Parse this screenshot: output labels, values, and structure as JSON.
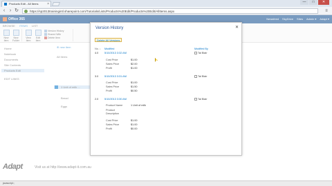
{
  "browser": {
    "tab_title": "Products Edit - All Items",
    "tab_close": "×",
    "url": "https://sp2013trainingintl.sharepoint.com/Tutorials/Lists/Products%20Edit/Products%20Edit/AllItems.aspx",
    "win_min": "—",
    "win_max": "□",
    "win_close": "✕",
    "back": "‹",
    "forward": "›",
    "refresh": "↻",
    "menu": "≡"
  },
  "suite": {
    "logo": "Office 365",
    "right_items": [
      "Newsfeed",
      "SkyDrive",
      "Sites",
      "Admin ▾",
      "Adapt ▾"
    ]
  },
  "ribbon": {
    "tabs": [
      "BROWSE",
      "ITEMS",
      "LIST"
    ],
    "active_tab": "ITEMS",
    "buttons": {
      "new_item": "New Item",
      "new_folder": "New Folder",
      "view_item": "View Item",
      "edit_item": "Edit Item",
      "version_history": "Version History",
      "shared_with": "Shared With",
      "delete_item": "Delete Item",
      "group_new": "New",
      "group_manage": "Manage"
    }
  },
  "leftnav": {
    "items": [
      "Home",
      "Notebook",
      "Documents",
      "Site Contents",
      "Products Edit",
      "EDIT LINKS"
    ]
  },
  "list": {
    "new_item": "⊕ new item",
    "header": "All Items",
    "selected_row": "1 Unit of milk ...",
    "row2": "Bread",
    "row3": "Eggs"
  },
  "dialog": {
    "title": "Version History",
    "close": "✕",
    "delete_all": "Delete All Versions",
    "col_no": "No. ↓",
    "col_modified": "Modified",
    "col_modified_by": "Modified By",
    "versions": [
      {
        "no": "4.0",
        "modified": "5/10/2013 3:32 AM",
        "by": "Tal Blair",
        "fields": [
          {
            "name": "Cost Price",
            "value": "$1.00"
          },
          {
            "name": "Sales Price",
            "value": "$2.00"
          },
          {
            "name": "Profit",
            "value": "$1.00"
          }
        ]
      },
      {
        "no": "3.0",
        "modified": "5/10/2013 3:31 AM",
        "by": "Tal Blair",
        "fields": [
          {
            "name": "Cost Price",
            "value": "$1.00"
          },
          {
            "name": "Sales Price",
            "value": "$1.50"
          },
          {
            "name": "Profit",
            "value": "$0.50"
          }
        ]
      },
      {
        "no": "2.0",
        "modified": "5/10/2013 3:30 AM",
        "by": "Tal Blair",
        "fields": [
          {
            "name": "Product Name",
            "value": "1 Unit of milk"
          },
          {
            "name": "Product Description",
            "value": ""
          },
          {
            "name": "Cost Price",
            "value": "$1.00"
          },
          {
            "name": "Sales Price",
            "value": "$1.00"
          },
          {
            "name": "Profit",
            "value": "$0.00"
          }
        ]
      }
    ]
  },
  "brand": {
    "logo": "Adapt",
    "text": "Visit us at http://www.adapt-it.com.au"
  },
  "status": {
    "text": "javascript:;"
  }
}
